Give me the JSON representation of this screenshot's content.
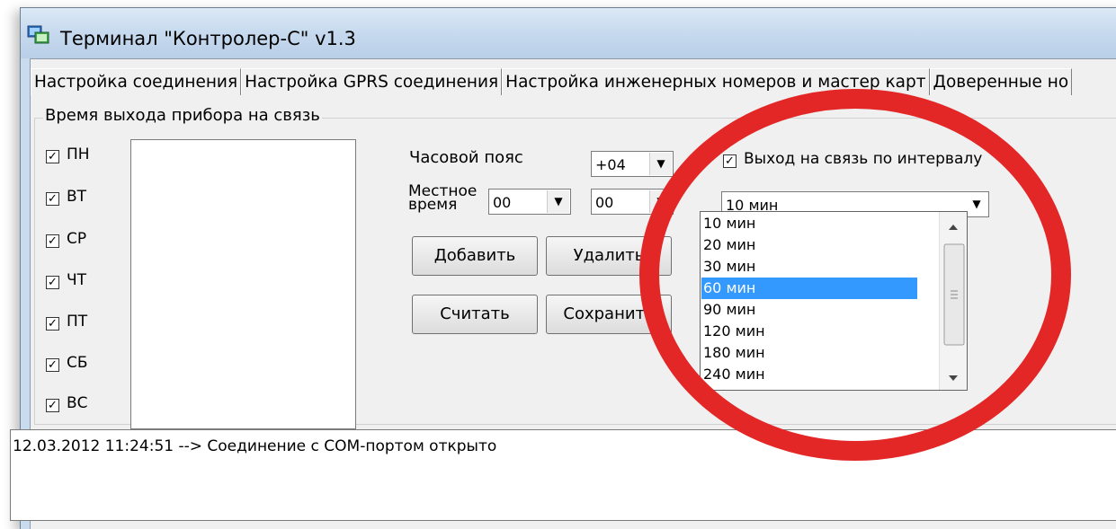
{
  "window": {
    "title": "Терминал \"Контролер-С\" v1.3"
  },
  "tabs": [
    "Настройка соединения",
    "Настройка GPRS соединения",
    "Настройка инженерных номеров и мастер карт",
    "Доверенные но"
  ],
  "schedule": {
    "group_title": "Время выхода прибора на связь",
    "days": [
      {
        "label": "ПН",
        "checked": true
      },
      {
        "label": "ВТ",
        "checked": true
      },
      {
        "label": "СР",
        "checked": true
      },
      {
        "label": "ЧТ",
        "checked": true
      },
      {
        "label": "ПТ",
        "checked": true
      },
      {
        "label": "СБ",
        "checked": true
      },
      {
        "label": "ВС",
        "checked": true
      }
    ],
    "timezone_label": "Часовой пояс",
    "timezone_value": "+04",
    "localtime_label_1": "Местное",
    "localtime_label_2": "время",
    "hours_value": "00",
    "minutes_value": "00",
    "add_button": "Добавить",
    "delete_button": "Удалить",
    "read_button": "Считать",
    "save_button": "Сохранить"
  },
  "interval": {
    "checkbox_label": "Выход на связь по интервалу",
    "checked": true,
    "selected": "10 мин",
    "options": [
      "10 мин",
      "20 мин",
      "30 мин",
      "60 мин",
      "90 мин",
      "120 мин",
      "180 мин",
      "240 мин"
    ],
    "highlighted": "60 мин"
  },
  "log": {
    "line": "12.03.2012 11:24:51 --> Соединение с COM-портом открыто"
  },
  "colors": {
    "highlight": "#3399ff",
    "annotation": "#e32626"
  }
}
